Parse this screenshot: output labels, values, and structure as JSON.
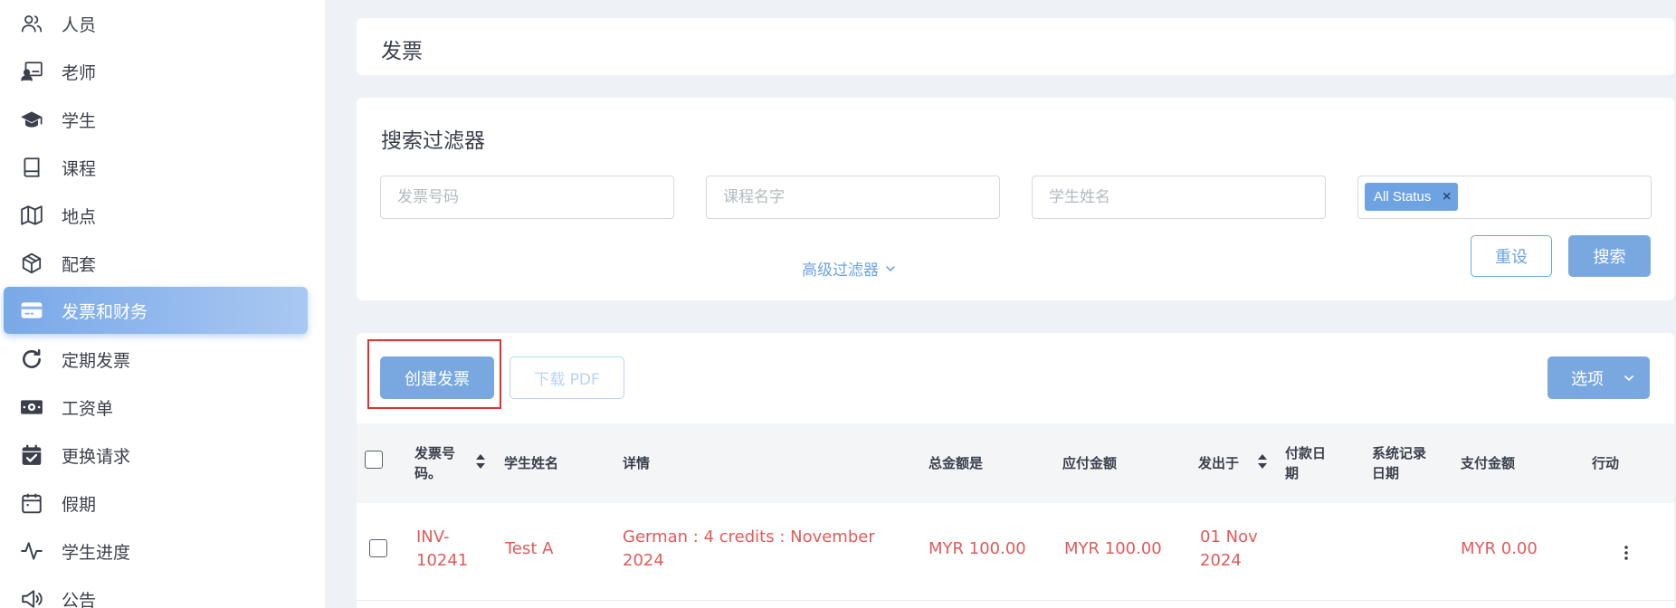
{
  "sidebar": {
    "items": [
      {
        "label": "人员",
        "icon": "users-icon",
        "active": false
      },
      {
        "label": "老师",
        "icon": "teacher-icon",
        "active": false
      },
      {
        "label": "学生",
        "icon": "graduation-cap-icon",
        "active": false
      },
      {
        "label": "课程",
        "icon": "book-icon",
        "active": false
      },
      {
        "label": "地点",
        "icon": "map-icon",
        "active": false
      },
      {
        "label": "配套",
        "icon": "package-icon",
        "active": false
      },
      {
        "label": "发票和财务",
        "icon": "credit-card-icon",
        "active": true
      },
      {
        "label": "定期发票",
        "icon": "refresh-icon",
        "active": false
      },
      {
        "label": "工资单",
        "icon": "money-icon",
        "active": false
      },
      {
        "label": "更换请求",
        "icon": "calendar-check-icon",
        "active": false
      },
      {
        "label": "假期",
        "icon": "calendar-icon",
        "active": false
      },
      {
        "label": "学生进度",
        "icon": "activity-icon",
        "active": false
      },
      {
        "label": "公告",
        "icon": "megaphone-icon",
        "active": false
      }
    ]
  },
  "page": {
    "title": "发票"
  },
  "filters": {
    "title": "搜索过滤器",
    "invoice_no_placeholder": "发票号码",
    "course_name_placeholder": "课程名字",
    "student_name_placeholder": "学生姓名",
    "status_chip": "All Status",
    "status_chip_remove": "×",
    "advanced_label": "高级过滤器",
    "reset_label": "重设",
    "search_label": "搜索"
  },
  "toolbar": {
    "create_label": "创建发票",
    "download_label": "下载 PDF",
    "options_label": "选项"
  },
  "table": {
    "headers": {
      "invoice_no": "发票号码。",
      "student_name": "学生姓名",
      "details": "详情",
      "total": "总金额是",
      "due": "应付金额",
      "issued": "发出于",
      "paid_date": "付款日期",
      "record_date": "系统记录日期",
      "paid_amount": "支付金额",
      "action": "行动"
    },
    "rows": [
      {
        "invoice_no": "INV-10241",
        "student_name": "Test A",
        "details": "German : 4 credits : November 2024",
        "total": "MYR 100.00",
        "due": "MYR 100.00",
        "issued": "01 Nov 2024",
        "paid_date": "",
        "record_date": "",
        "paid_amount": "MYR 0.00"
      }
    ]
  },
  "colors": {
    "accent": "#6ea3e3",
    "danger_text": "#e15a5a",
    "highlight": "#e03030"
  }
}
